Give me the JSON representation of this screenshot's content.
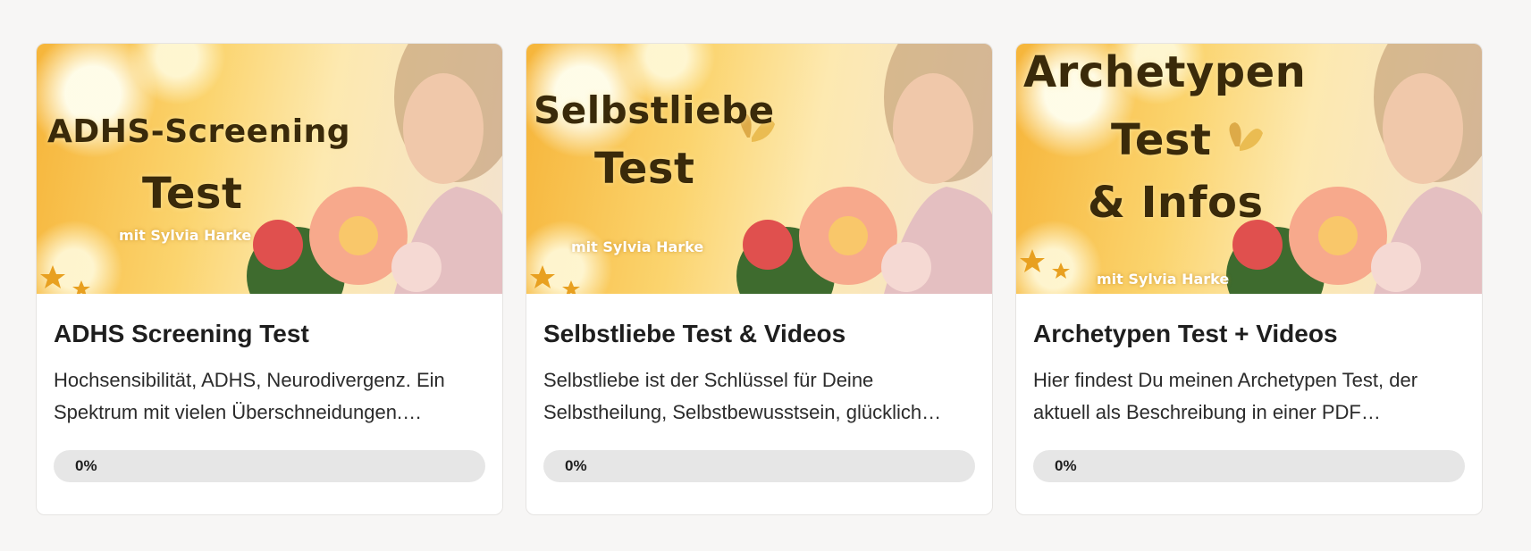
{
  "courses": [
    {
      "thumbnail": {
        "line1": "ADHS-Screening",
        "line2": "Test",
        "line3": "",
        "byline": "mit Sylvia Harke"
      },
      "title": "ADHS Screening Test",
      "desc_line1": "Hochsensibilität, ADHS, Neurodivergenz. Ein",
      "desc_line2": "Spektrum mit vielen Überschneidungen.…",
      "progress_label": "0%",
      "progress_value": 0
    },
    {
      "thumbnail": {
        "line1": "Selbstliebe",
        "line2": "Test",
        "line3": "",
        "byline": "mit Sylvia Harke"
      },
      "title": "Selbstliebe Test & Videos",
      "desc_line1": "Selbstliebe ist der Schlüssel für Deine",
      "desc_line2": "Selbstheilung, Selbstbewusstsein, glücklich…",
      "progress_label": "0%",
      "progress_value": 0
    },
    {
      "thumbnail": {
        "line1": "Archetypen",
        "line2": "Test",
        "line3": "& Infos",
        "byline": "mit Sylvia Harke"
      },
      "title": "Archetypen Test + Videos",
      "desc_line1": "Hier findest Du meinen Archetypen Test, der",
      "desc_line2": "aktuell als Beschreibung in einer PDF…",
      "progress_label": "0%",
      "progress_value": 0
    }
  ],
  "colors": {
    "background": "#f7f6f5",
    "card": "#ffffff",
    "progress_track": "#e6e6e6"
  }
}
